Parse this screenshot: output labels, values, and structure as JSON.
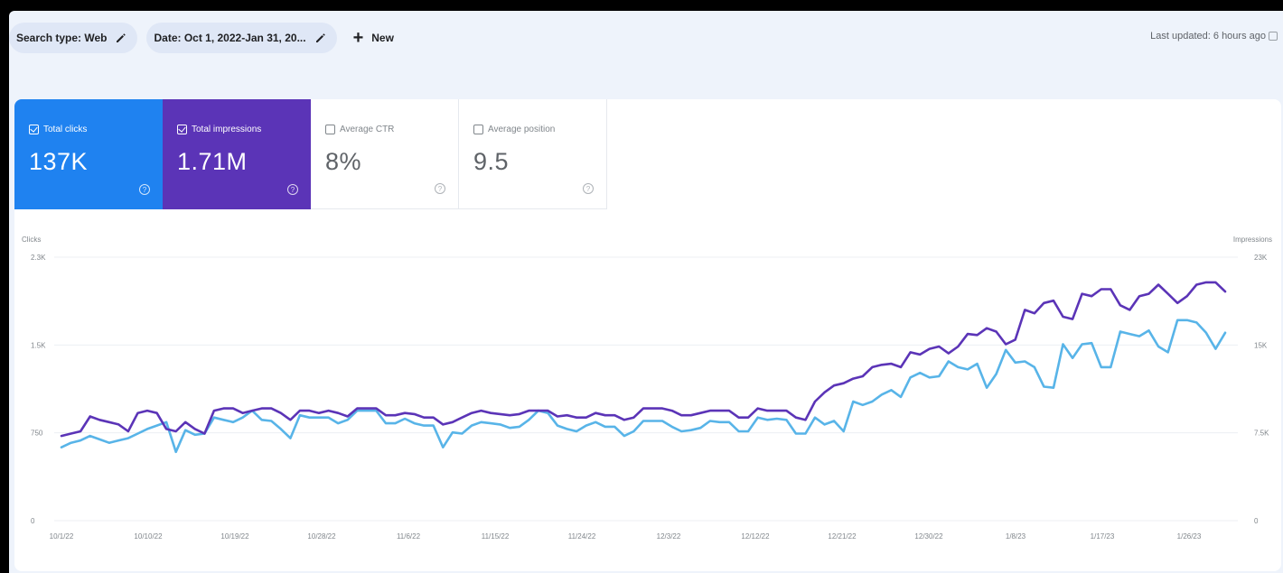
{
  "toolbar": {
    "search_type_chip": "Search type: Web",
    "date_chip": "Date: Oct 1, 2022-Jan 31, 20...",
    "new_button": "New",
    "last_updated": "Last updated: 6 hours ago"
  },
  "metrics": [
    {
      "label": "Total clicks",
      "value": "137K",
      "checked": true,
      "color": "#1f82f0"
    },
    {
      "label": "Total impressions",
      "value": "1.71M",
      "checked": true,
      "color": "#5b34b7"
    },
    {
      "label": "Average CTR",
      "value": "8%",
      "checked": false
    },
    {
      "label": "Average position",
      "value": "9.5",
      "checked": false
    }
  ],
  "chart_data": {
    "type": "line",
    "left_axis_title": "Clicks",
    "right_axis_title": "Impressions",
    "left_ticks": [
      "0",
      "750",
      "1.5K",
      "2.3K"
    ],
    "right_ticks": [
      "0",
      "7.5K",
      "15K",
      "23K"
    ],
    "x_ticks": [
      "10/1/22",
      "10/10/22",
      "10/19/22",
      "10/28/22",
      "11/6/22",
      "11/15/22",
      "11/24/22",
      "12/3/22",
      "12/12/22",
      "12/21/22",
      "12/30/22",
      "1/8/23",
      "1/17/23",
      "1/26/23"
    ],
    "ylim_left": [
      0,
      2300
    ],
    "ylim_right": [
      0,
      23000
    ],
    "grid": true,
    "series": [
      {
        "name": "Clicks",
        "color": "#58b4e8",
        "axis": "left",
        "values": [
          640,
          680,
          700,
          740,
          710,
          680,
          700,
          720,
          760,
          800,
          830,
          860,
          600,
          790,
          750,
          760,
          900,
          880,
          860,
          900,
          960,
          880,
          870,
          800,
          720,
          920,
          900,
          900,
          900,
          850,
          880,
          960,
          960,
          960,
          850,
          850,
          890,
          850,
          830,
          830,
          640,
          770,
          760,
          830,
          860,
          850,
          840,
          810,
          820,
          880,
          960,
          940,
          830,
          800,
          780,
          830,
          860,
          820,
          820,
          740,
          780,
          870,
          870,
          870,
          820,
          780,
          790,
          810,
          870,
          860,
          860,
          780,
          780,
          900,
          880,
          890,
          880,
          760,
          760,
          900,
          840,
          870,
          780,
          1040,
          1010,
          1040,
          1100,
          1140,
          1080,
          1250,
          1290,
          1250,
          1260,
          1390,
          1340,
          1320,
          1370,
          1160,
          1280,
          1490,
          1380,
          1390,
          1340,
          1170,
          1160,
          1540,
          1420,
          1540,
          1550,
          1340,
          1340,
          1650,
          1630,
          1610,
          1660,
          1520,
          1470,
          1750,
          1750,
          1730,
          1640,
          1500,
          1640
        ]
      },
      {
        "name": "Impressions",
        "color": "#5b34b7",
        "axis": "right",
        "values": [
          7400,
          7600,
          7800,
          9100,
          8800,
          8600,
          8400,
          7800,
          9400,
          9600,
          9400,
          8000,
          7800,
          8600,
          8000,
          7600,
          9600,
          9800,
          9800,
          9400,
          9600,
          9800,
          9800,
          9400,
          8800,
          9600,
          9600,
          9400,
          9600,
          9400,
          9100,
          9800,
          9800,
          9800,
          9200,
          9200,
          9400,
          9300,
          9000,
          9000,
          8400,
          8600,
          9000,
          9400,
          9600,
          9400,
          9300,
          9200,
          9300,
          9600,
          9600,
          9600,
          9100,
          9200,
          9000,
          9000,
          9400,
          9200,
          9200,
          8800,
          9000,
          9800,
          9800,
          9800,
          9600,
          9200,
          9200,
          9400,
          9600,
          9600,
          9600,
          9000,
          9000,
          9800,
          9600,
          9600,
          9600,
          9000,
          8800,
          10400,
          11200,
          11800,
          12000,
          12400,
          12600,
          13400,
          13600,
          13700,
          13400,
          14700,
          14500,
          15000,
          15200,
          14600,
          15200,
          16300,
          16200,
          16800,
          16500,
          15400,
          15800,
          18400,
          18100,
          19000,
          19200,
          17800,
          17600,
          19800,
          19600,
          20200,
          20200,
          18800,
          18400,
          19600,
          19800,
          20600,
          19800,
          19000,
          19600,
          20600,
          20800,
          20800,
          20000
        ]
      }
    ]
  }
}
